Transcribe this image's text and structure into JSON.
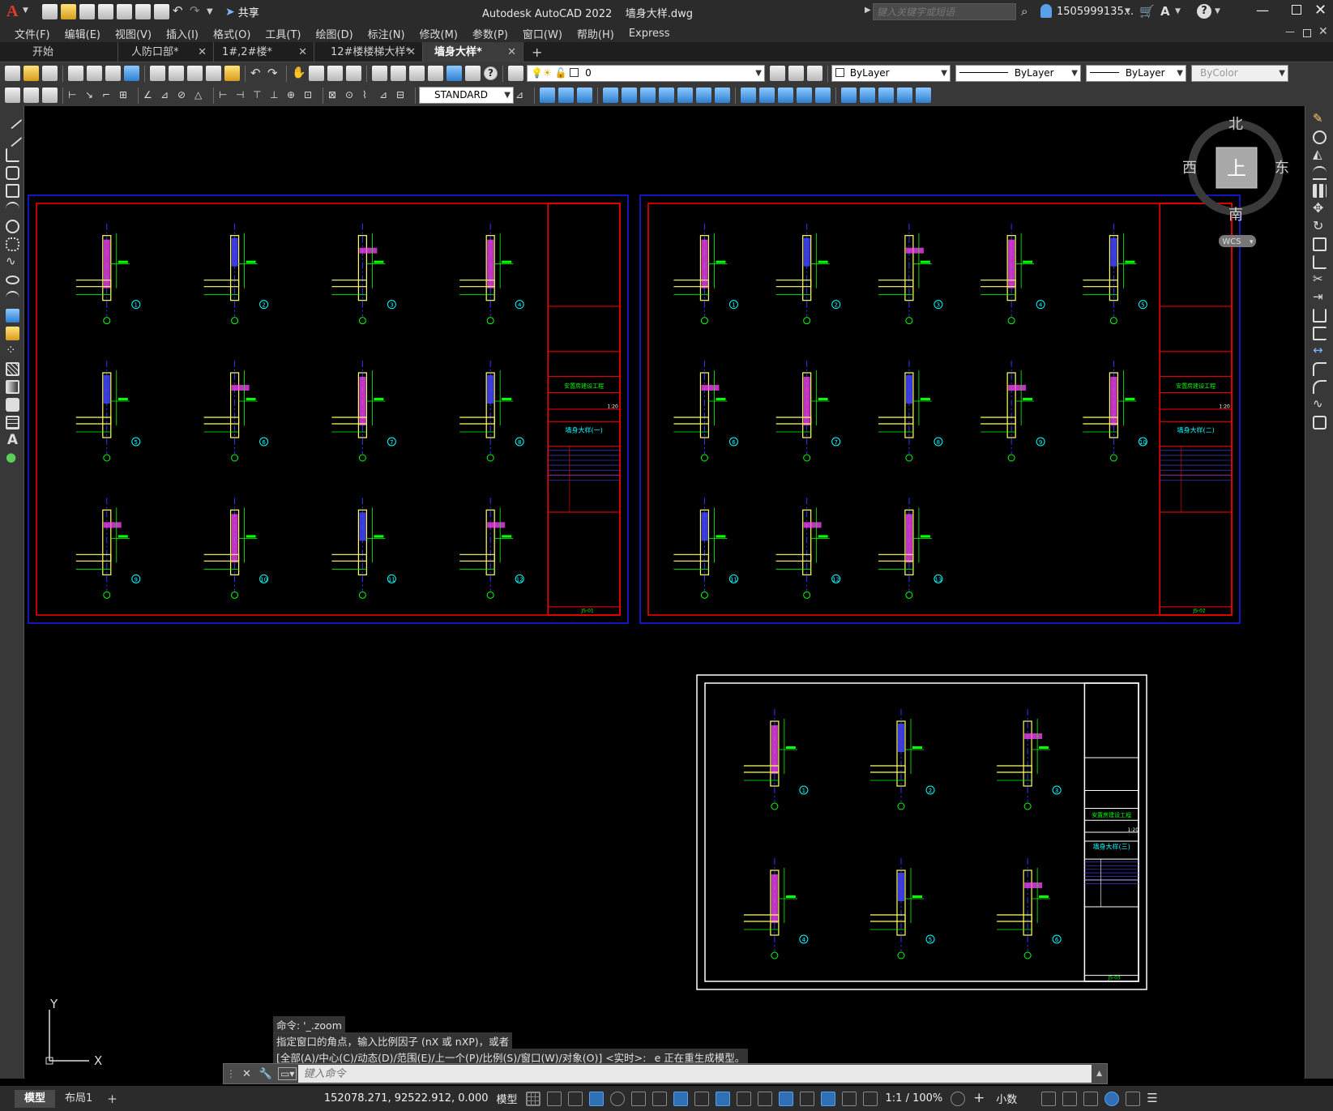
{
  "app": {
    "logo": "A",
    "title": "Autodesk AutoCAD 2022    墙身大样.dwg",
    "share_label": "共享",
    "search_placeholder": "键入关键字或短语",
    "user": "1505999135...",
    "help": "?"
  },
  "menus": [
    "文件(F)",
    "编辑(E)",
    "视图(V)",
    "插入(I)",
    "格式(O)",
    "工具(T)",
    "绘图(D)",
    "标注(N)",
    "修改(M)",
    "参数(P)",
    "窗口(W)",
    "帮助(H)",
    "Express"
  ],
  "tabs": [
    {
      "label": "开始",
      "closable": false
    },
    {
      "label": "人防口部*",
      "closable": true
    },
    {
      "label": "1#,2#楼*",
      "closable": true
    },
    {
      "label": "12#楼楼梯大样*",
      "closable": true
    },
    {
      "label": "墙身大样*",
      "closable": true,
      "active": true
    }
  ],
  "toolbar": {
    "layer": "0",
    "color": "ByLayer",
    "linetype": "ByLayer",
    "lineweight": "ByLayer",
    "plotstyle": "ByColor",
    "textstyle": "STANDARD"
  },
  "viewcube": {
    "north": "北",
    "south": "南",
    "east": "东",
    "west": "西",
    "top": "上",
    "wcs": "WCS"
  },
  "ucs": {
    "x": "X",
    "y": "Y"
  },
  "command": {
    "history": [
      "命令: '_.zoom",
      "指定窗口的角点，输入比例因子 (nX 或 nXP)，或者",
      "[全部(A)/中心(C)/动态(D)/范围(E)/上一个(P)/比例(S)/窗口(W)/对象(O)] <实时>: _e 正在重生成模型。"
    ],
    "placeholder": "键入命令"
  },
  "status": {
    "layout_tabs": [
      "模型",
      "布局1"
    ],
    "coords": "152078.271, 92522.912, 0.000",
    "space": "模型",
    "scale": "1:1 / 100%",
    "units": "小数"
  },
  "sheets": [
    {
      "id": "s1",
      "title_block": "墙身大样(一)",
      "project": "安置房建设工程",
      "dwg_no": "JS-01",
      "scale": "1:20",
      "detail_labels": [
        "1",
        "2",
        "3",
        "4",
        "5",
        "6",
        "7",
        "8",
        "9",
        "10",
        "11",
        "12"
      ]
    },
    {
      "id": "s2",
      "title_block": "墙身大样(二)",
      "project": "安置房建设工程",
      "dwg_no": "JS-02",
      "scale": "1:20",
      "detail_labels": [
        "1",
        "2",
        "3",
        "4",
        "5",
        "6",
        "7",
        "8",
        "9",
        "10",
        "11",
        "12",
        "13"
      ]
    },
    {
      "id": "s3",
      "title_block": "墙身大样(三)",
      "project": "安置房建设工程",
      "dwg_no": "JS-03",
      "scale": "1:20",
      "detail_labels": [
        "1",
        "2",
        "3",
        "4",
        "5",
        "6"
      ]
    }
  ],
  "colors": {
    "sheet_outer": "#1a1aff",
    "sheet_frame": "#ff0000",
    "dim": "#00ff00",
    "wall": "#ffff66",
    "hatch": "#ff44ff",
    "column": "#4444ff",
    "tag": "#00ffff",
    "axis": "#3333ff",
    "sheet3_frame": "#ffffff"
  }
}
